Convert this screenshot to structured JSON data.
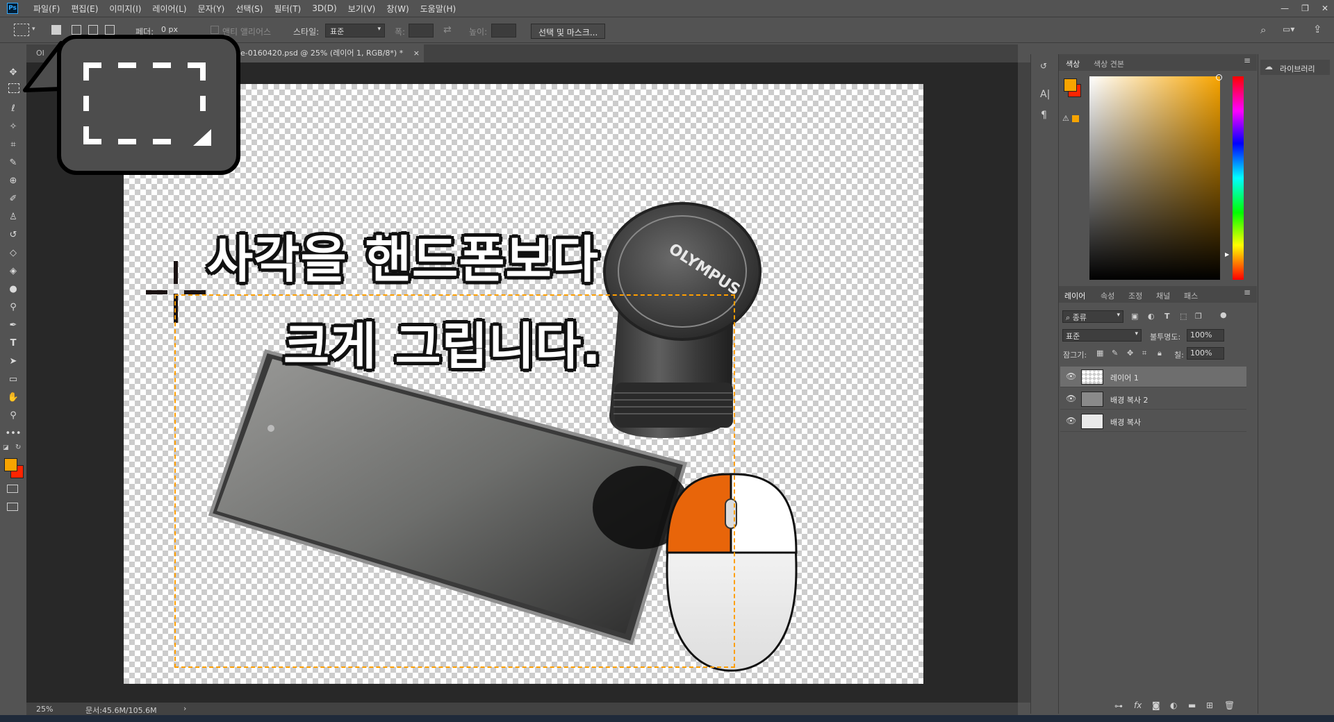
{
  "menubar": {
    "logo": "Ps",
    "items": [
      "파일(F)",
      "편집(E)",
      "이미지(I)",
      "레이어(L)",
      "문자(Y)",
      "선택(S)",
      "필터(T)",
      "3D(D)",
      "보기(V)",
      "창(W)",
      "도움말(H)"
    ]
  },
  "options": {
    "feather_label": "페더:",
    "feather_value": "0 px",
    "antialias_label": "앤티 앨리어스",
    "style_label": "스타일:",
    "style_value": "표준",
    "width_label": "폭:",
    "height_label": "높이:",
    "select_mask_button": "선택 및 마스크..."
  },
  "document": {
    "tab_left": "OI",
    "tab_title": "e-0160420.psd @ 25% (레이어 1, RGB/8*) *",
    "tab_close": "×",
    "headline_line1": "사각을 핸드폰보다",
    "headline_line2": "크게 그립니다.",
    "lens_brand": "OLYMPUS",
    "zoom": "25%",
    "doc_size": "문서:45.6M/105.6M"
  },
  "panels": {
    "color_tabs": [
      "색상",
      "색상 견본"
    ],
    "library_label": "라이브러리",
    "layer_tabs": [
      "레이어",
      "속성",
      "조정",
      "채널",
      "패스"
    ],
    "kind_filter": "종류",
    "blend_mode": "표준",
    "opacity_label": "불투명도:",
    "opacity_value": "100%",
    "lock_label": "잠그기:",
    "fill_label": "칠:",
    "fill_value": "100%",
    "layers": [
      {
        "name": "레이어 1",
        "selected": true
      },
      {
        "name": "배경 복사 2",
        "selected": false
      },
      {
        "name": "배경 복사",
        "selected": false
      }
    ],
    "fx_label": "fx"
  },
  "colors": {
    "foreground": "#f7a400",
    "background": "#ff2400",
    "marquee": "#ff9e00",
    "mouse_accent": "#e8650a"
  }
}
